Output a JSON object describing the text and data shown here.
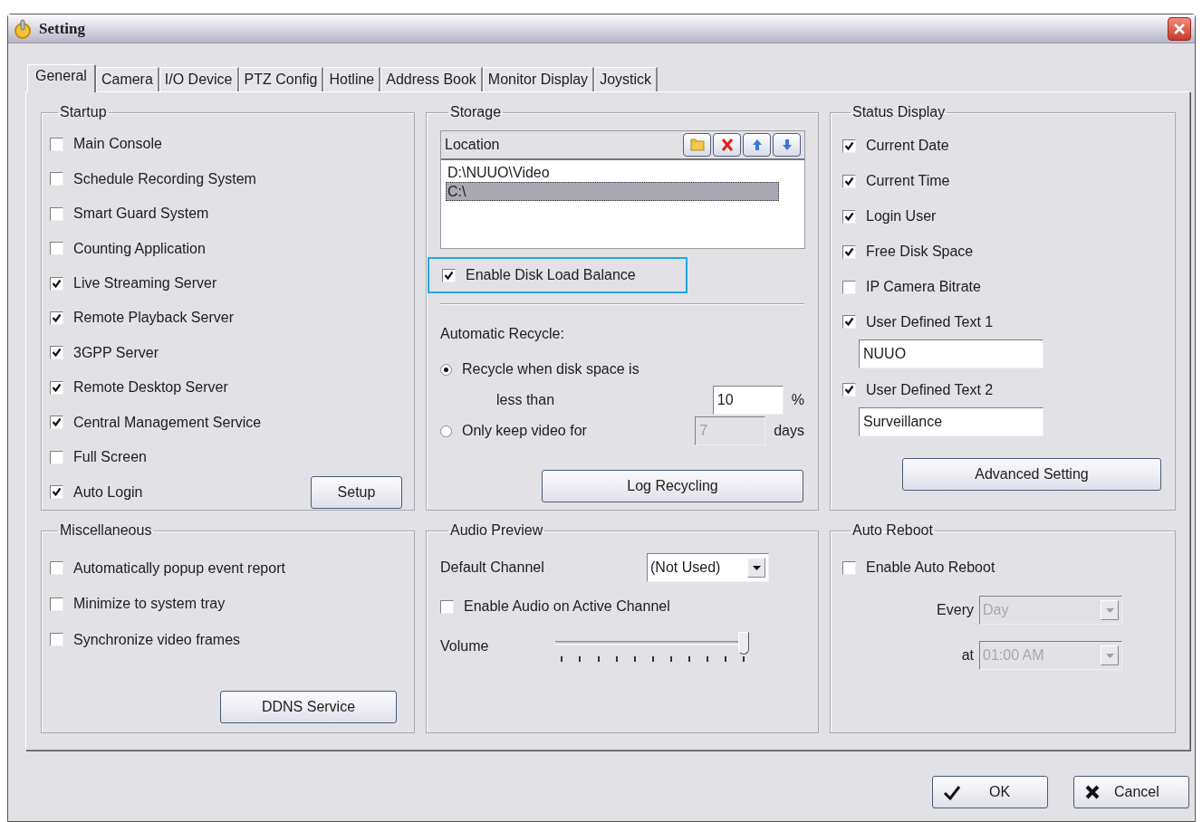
{
  "window": {
    "title": "Setting"
  },
  "tabs": [
    {
      "label": "General",
      "selected": true
    },
    {
      "label": "Camera",
      "selected": false
    },
    {
      "label": "I/O Device",
      "selected": false
    },
    {
      "label": "PTZ Config",
      "selected": false
    },
    {
      "label": "Hotline",
      "selected": false
    },
    {
      "label": "Address Book",
      "selected": false
    },
    {
      "label": "Monitor Display",
      "selected": false
    },
    {
      "label": "Joystick",
      "selected": false
    }
  ],
  "startup": {
    "title": "Startup",
    "options": [
      {
        "label": "Main Console",
        "checked": false
      },
      {
        "label": "Schedule Recording System",
        "checked": false
      },
      {
        "label": "Smart Guard System",
        "checked": false
      },
      {
        "label": "Counting Application",
        "checked": false
      },
      {
        "label": "Live Streaming Server",
        "checked": true
      },
      {
        "label": "Remote Playback Server",
        "checked": true
      },
      {
        "label": "3GPP Server",
        "checked": true
      },
      {
        "label": "Remote Desktop Server",
        "checked": true
      },
      {
        "label": "Central Management Service",
        "checked": true
      },
      {
        "label": "Full Screen",
        "checked": false
      },
      {
        "label": "Auto Login",
        "checked": true
      }
    ],
    "button": "Setup"
  },
  "storage": {
    "title": "Storage",
    "location_header": "Location",
    "locations": [
      {
        "path": "D:\\NUUO\\Video",
        "selected": false
      },
      {
        "path": "C:\\",
        "selected": true
      }
    ],
    "disk_load_balance": {
      "label": "Enable Disk Load Balance",
      "checked": true,
      "highlighted": true
    },
    "recycle_label": "Automatic Recycle:",
    "recycle_options": [
      {
        "label": "Recycle when disk space is",
        "selected": true,
        "prefix": "less than",
        "value": "10",
        "unit": "%",
        "disabled": false
      },
      {
        "label": "Only keep video for",
        "selected": false,
        "value": "7",
        "unit": "days",
        "disabled": true
      }
    ],
    "button": "Log Recycling"
  },
  "status_display": {
    "title": "Status Display",
    "options": [
      {
        "label": "Current Date",
        "checked": true
      },
      {
        "label": "Current Time",
        "checked": true
      },
      {
        "label": "Login User",
        "checked": true
      },
      {
        "label": "Free Disk Space",
        "checked": true
      },
      {
        "label": "IP Camera Bitrate",
        "checked": false
      },
      {
        "label": "User Defined Text 1",
        "checked": true,
        "value": "NUUO"
      },
      {
        "label": "User Defined Text 2",
        "checked": true,
        "value": "Surveillance"
      }
    ],
    "button": "Advanced Setting"
  },
  "miscellaneous": {
    "title": "Miscellaneous",
    "options": [
      {
        "label": "Automatically popup event report",
        "checked": false
      },
      {
        "label": "Minimize to system tray",
        "checked": false
      },
      {
        "label": "Synchronize video frames",
        "checked": false
      }
    ],
    "button": "DDNS Service"
  },
  "audio_preview": {
    "title": "Audio Preview",
    "channel_label": "Default Channel",
    "channel_value": "(Not Used)",
    "active_channel": {
      "label": "Enable Audio on Active Channel",
      "checked": false
    },
    "volume_label": "Volume",
    "volume": {
      "level": 1
    }
  },
  "auto_reboot": {
    "title": "Auto Reboot",
    "enable": {
      "label": "Enable Auto Reboot",
      "checked": false
    },
    "fields": [
      {
        "label": "Every",
        "value": "Day",
        "disabled": true
      },
      {
        "label": "at",
        "value": "01:00 AM",
        "disabled": true
      }
    ]
  },
  "buttons": [
    {
      "kind": "ok",
      "label": "OK"
    },
    {
      "kind": "cancel",
      "label": "Cancel"
    }
  ]
}
